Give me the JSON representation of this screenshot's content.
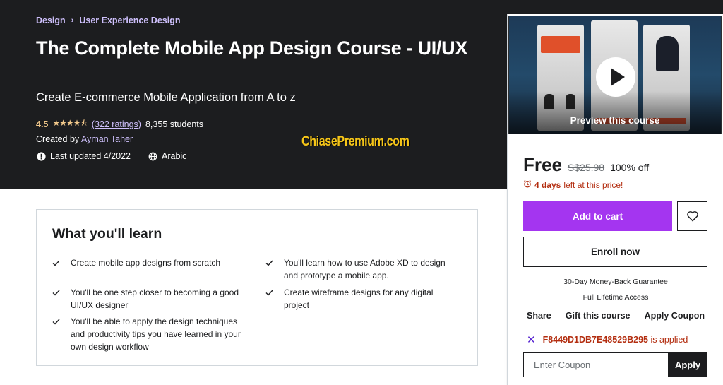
{
  "breadcrumb": [
    {
      "label": "Design"
    },
    {
      "label": "User Experience Design"
    }
  ],
  "course": {
    "title": "The Complete Mobile App Design Course - UI/UX",
    "subtitle": "Create E-commerce Mobile Application from A to z",
    "rating": "4.5",
    "stars": "★★★★⯪",
    "ratings_count": "(322 ratings)",
    "students": "8,355 students",
    "created_by_label": "Created by",
    "instructor": "Ayman Taher",
    "last_updated": "Last updated 4/2022",
    "language": "Arabic"
  },
  "watermark": "ChiasePremium.com",
  "sidebar": {
    "preview_label": "Preview this course",
    "price": "Free",
    "original_price": "S$25.98",
    "discount": "100% off",
    "countdown_bold": "4 days",
    "countdown_rest": "left at this price!",
    "add_to_cart": "Add to cart",
    "enroll_now": "Enroll now",
    "guarantee": "30-Day Money-Back Guarantee",
    "lifetime": "Full Lifetime Access",
    "share": "Share",
    "gift": "Gift this course",
    "apply_coupon": "Apply Coupon",
    "coupon_code": "F8449D1DB7E48529B295",
    "coupon_applied_text": "is applied",
    "coupon_placeholder": "Enter Coupon",
    "apply_button": "Apply"
  },
  "learn": {
    "title": "What you'll learn",
    "items": [
      "Create mobile app designs from scratch",
      "You'll be one step closer to becoming a good UI/UX designer",
      "You'll be able to apply the design techniques and productivity tips you have learned in your own design workflow",
      "You'll learn how to use Adobe XD to design and prototype a mobile app.",
      "Create wireframe designs for any digital project"
    ]
  },
  "colors": {
    "hero_bg": "#1c1d1f",
    "accent_purple": "#a435f0",
    "link_lavender": "#cec0fc",
    "star_gold": "#f3ca8c",
    "alert_red": "#b32d0f"
  }
}
